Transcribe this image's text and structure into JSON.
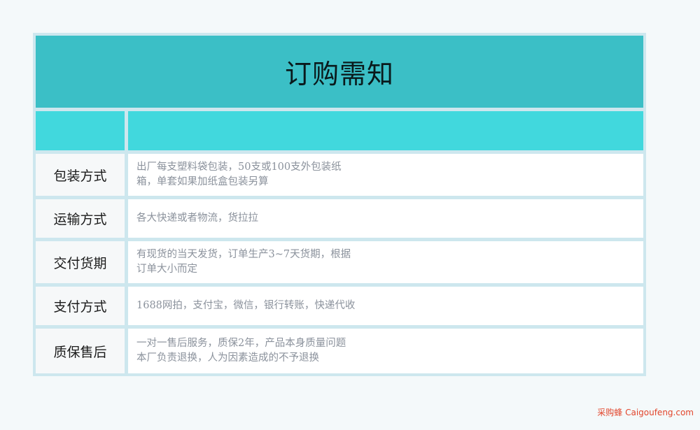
{
  "title": "订购需知",
  "rows": [
    {
      "label": "包装方式",
      "lines": [
        "出厂每支塑料袋包装，50支或100支外包装纸",
        "箱，单套如果加纸盒包装另算"
      ]
    },
    {
      "label": "运输方式",
      "lines": [
        "各大快递或者物流，货拉拉"
      ]
    },
    {
      "label": "交付货期",
      "lines": [
        "有现货的当天发货，订单生产3~7天货期，根据",
        "订单大小而定"
      ]
    },
    {
      "label": "支付方式",
      "lines": [
        "1688网拍，支付宝，微信，银行转账，快递代收"
      ]
    },
    {
      "label": "质保售后",
      "lines": [
        "一对一售后服务，质保2年，产品本身质量问题",
        "本厂负责退换，人为因素造成的不予退换"
      ]
    }
  ],
  "watermark": "采购蜂 Caigoufeng.com",
  "colors": {
    "title_bg": "#3bbfc6",
    "header_bg": "#41d8dd",
    "border": "#cde7ee",
    "value_text": "#8b929c",
    "watermark": "#e2452b"
  }
}
